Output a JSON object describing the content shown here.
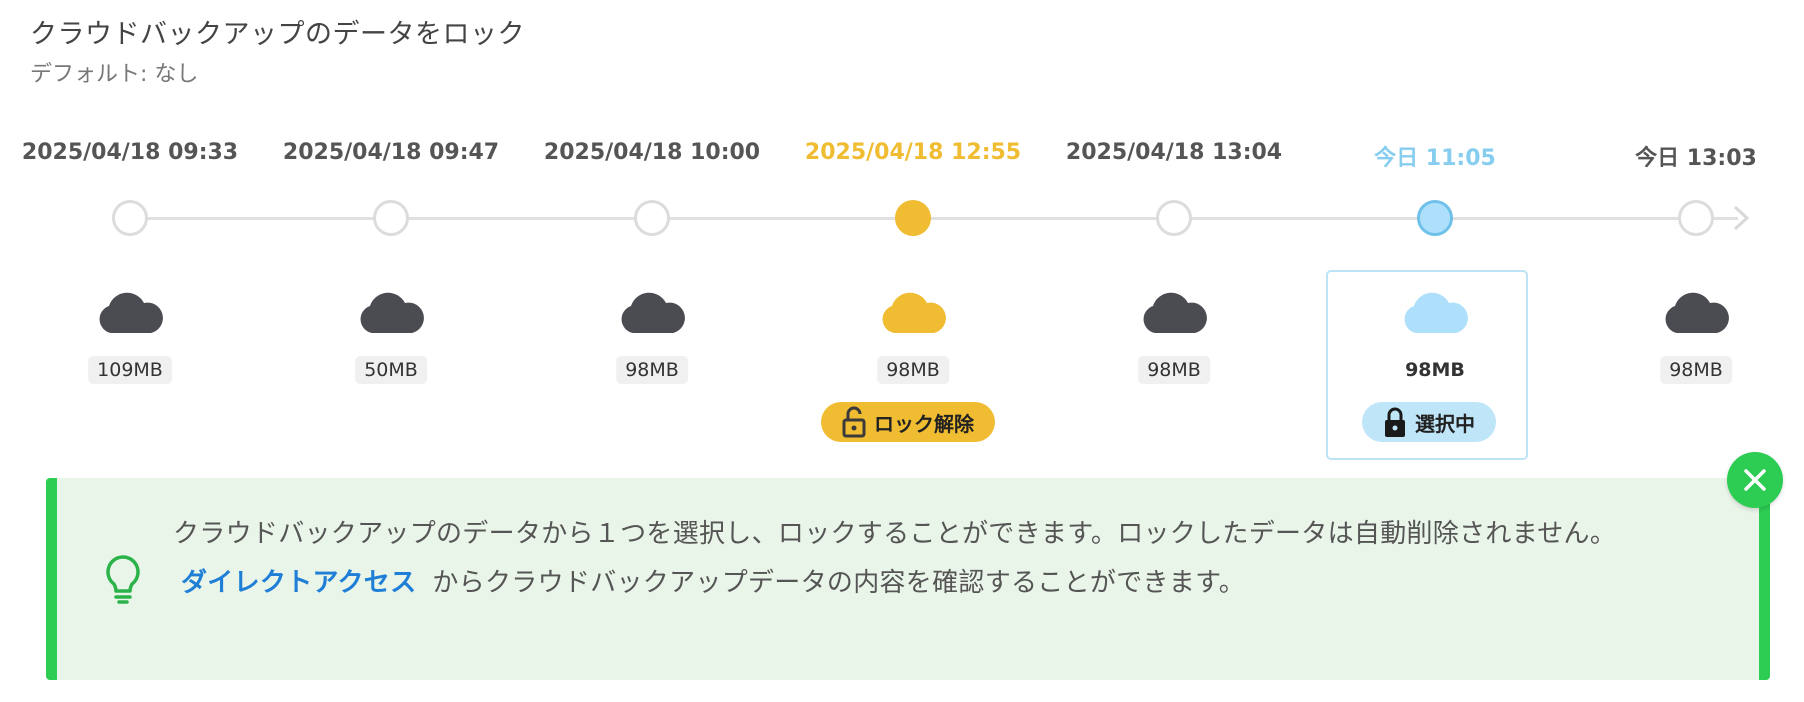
{
  "header": {
    "title": "クラウドバックアップのデータをロック",
    "subtitle": "デフォルト: なし"
  },
  "snapshots": [
    {
      "date": "2025/04/18 09:33",
      "size": "109MB",
      "state": "normal"
    },
    {
      "date": "2025/04/18 09:47",
      "size": "50MB",
      "state": "normal"
    },
    {
      "date": "2025/04/18 10:00",
      "size": "98MB",
      "state": "normal"
    },
    {
      "date": "2025/04/18 12:55",
      "size": "98MB",
      "state": "locked",
      "badge": "ロック解除"
    },
    {
      "date": "2025/04/18 13:04",
      "size": "98MB",
      "state": "normal"
    },
    {
      "date": "今日 11:05",
      "size": "98MB",
      "state": "selected",
      "badge": "選択中"
    },
    {
      "date": "今日 13:03",
      "size": "98MB",
      "state": "normal"
    }
  ],
  "info": {
    "line1": "クラウドバックアップのデータから１つを選択し、ロックすることができます。ロックしたデータは自動削除されません。",
    "link": "ダイレクトアクセス",
    "line2_rest": "からクラウドバックアップデータの内容を確認することができます。"
  },
  "icons": {
    "snapshot": "cloud-icon",
    "unlock": "unlocked-padlock-icon",
    "selected": "padlock-icon",
    "tip": "lightbulb-icon",
    "close": "close-icon"
  },
  "colors": {
    "cloud_default": "#4a4c52",
    "locked": "#f0bc32",
    "selected": "#aee0fb",
    "accent_green": "#2dcc53",
    "link": "#1f7fd6",
    "info_bg": "#eaf5ea"
  }
}
